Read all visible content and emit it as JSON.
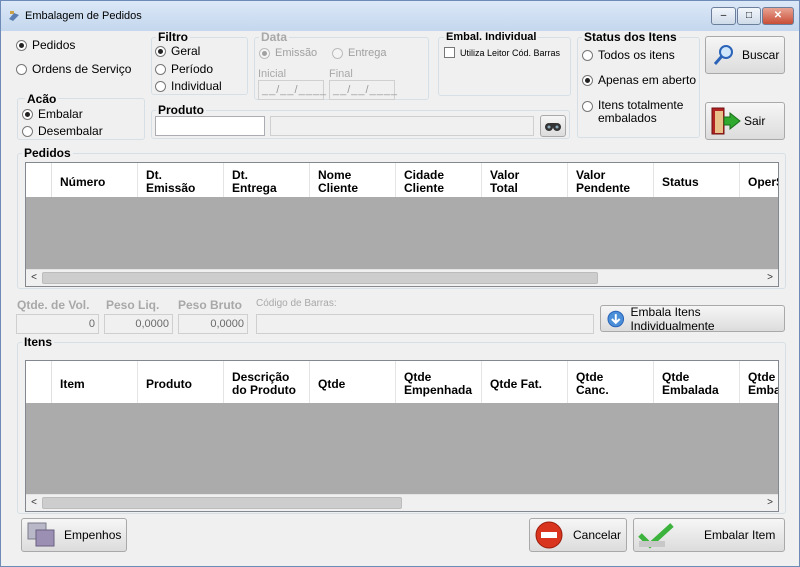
{
  "window": {
    "title": "Embalagem de Pedidos",
    "buttons": {
      "minimize": "‒",
      "maximize": "□",
      "close": "✕"
    }
  },
  "tipo": {
    "pedidos": "Pedidos",
    "ordens": "Ordens de Serviço",
    "selected": "Pedidos"
  },
  "filtro": {
    "title": "Filtro",
    "geral": "Geral",
    "periodo": "Período",
    "individual": "Individual",
    "selected": "Geral"
  },
  "data": {
    "title": "Data",
    "emissao": "Emissão",
    "entrega": "Entrega",
    "inicial_label": "Inicial",
    "final_label": "Final",
    "inicial_value": "__/__/____",
    "final_value": "__/__/____",
    "selected": "Emissão"
  },
  "embal_individual": {
    "title": "Embal. Individual",
    "checkbox_label": "Utiliza Leitor Cód. Barras"
  },
  "status_itens": {
    "title": "Status dos Itens",
    "todos": "Todos os itens",
    "abertos": "Apenas em aberto",
    "totalmente": "Itens totalmente embalados",
    "selected": "Apenas em aberto"
  },
  "acao": {
    "title": "Acão",
    "embalar": "Embalar",
    "desembalar": "Desembalar",
    "selected": "Embalar"
  },
  "produto": {
    "title": "Produto",
    "code_value": "",
    "desc_value": ""
  },
  "buttons": {
    "buscar": "Buscar",
    "sair": "Sair",
    "embala_individual": "Embala Itens Individualmente",
    "empenhos": "Empenhos",
    "cancelar": "Cancelar",
    "embalar_item": "Embalar Item"
  },
  "pedidos": {
    "title": "Pedidos",
    "columns": [
      "Número",
      "Dt.\nEmissão",
      "Dt.\nEntrega",
      "Nome\nCliente",
      "Cidade\nCliente",
      "Valor\nTotal",
      "Valor\nPendente",
      "Status",
      "OperS"
    ]
  },
  "totais": {
    "vol_label": "Qtde. de Vol.",
    "peso_liq_label": "Peso Liq.",
    "peso_bruto_label": "Peso Bruto",
    "codigo_barras_label": "Código de Barras:",
    "vol_value": "0",
    "peso_liq_value": "0,0000",
    "peso_bruto_value": "0,0000",
    "codigo_barras_value": ""
  },
  "itens": {
    "title": "Itens",
    "columns": [
      "Item",
      "Produto",
      "Descrição\ndo Produto",
      "Qtde",
      "Qtde\nEmpenhada",
      "Qtde Fat.",
      "Qtde\nCanc.",
      "Qtde\nEmbalada",
      "Qtde\nEmbal"
    ]
  },
  "colors": {
    "accent": "#2a63b8",
    "close": "#c84d36",
    "grid_bg": "#ababab"
  }
}
